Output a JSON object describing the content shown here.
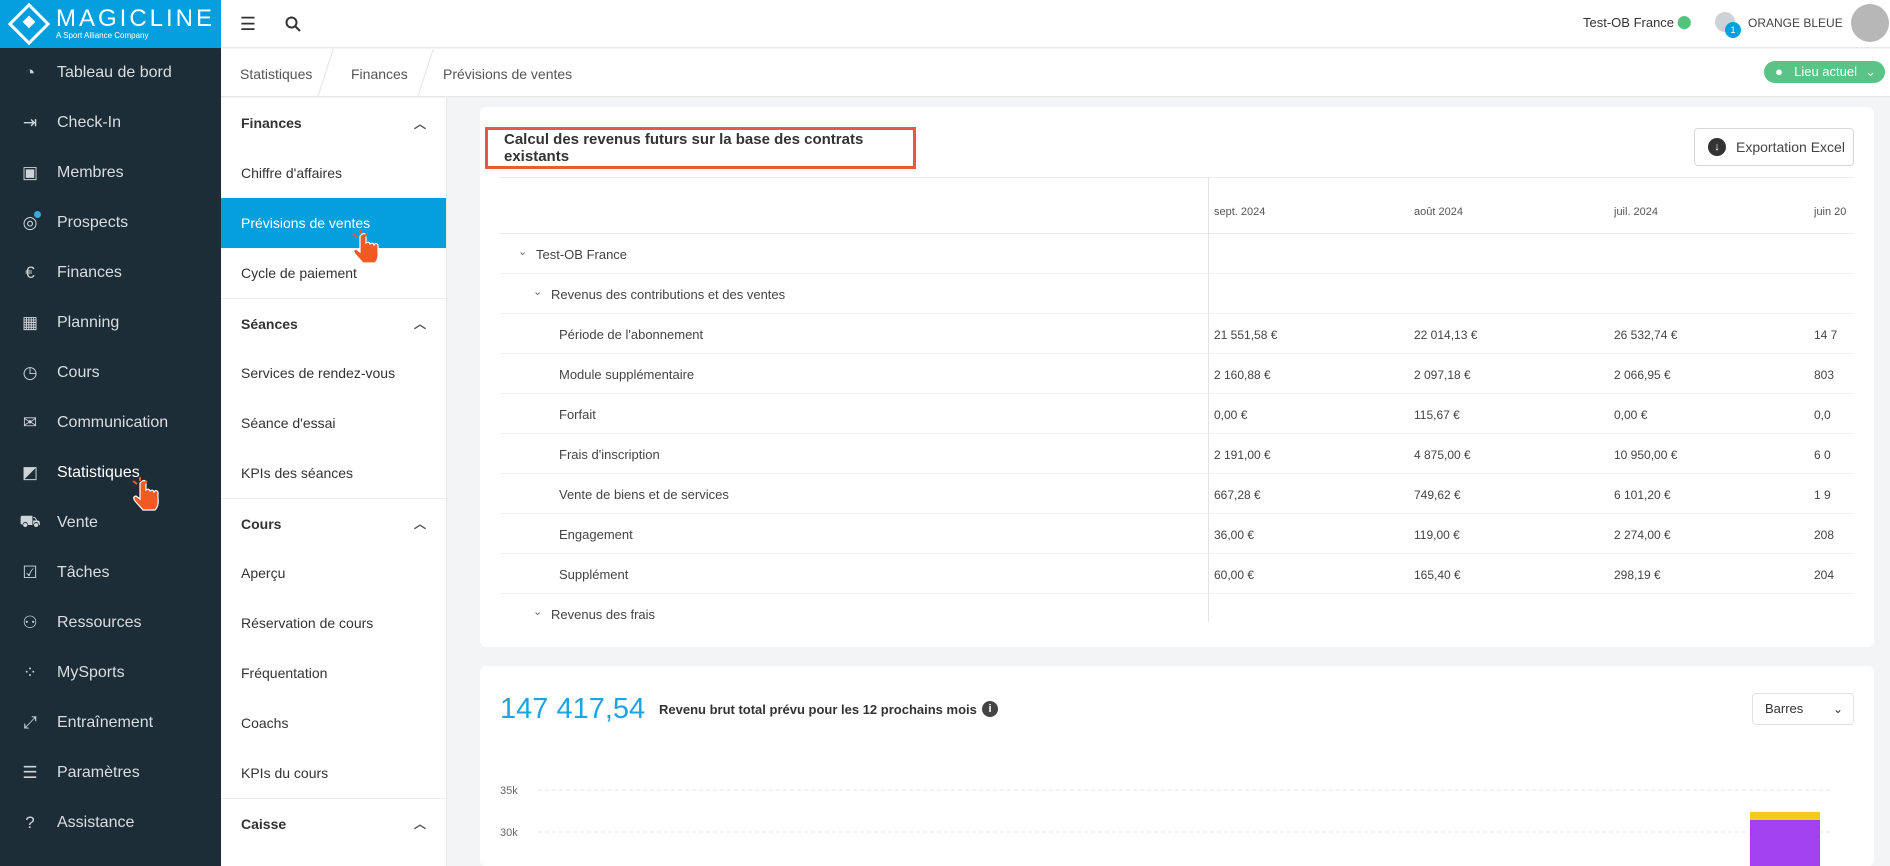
{
  "brand": {
    "name": "MAGICLINE",
    "tagline": "A Sport Alliance Company"
  },
  "sidebar": {
    "items": [
      {
        "label": "Tableau de bord",
        "icon": "dashboard-icon",
        "glyph": "◔"
      },
      {
        "label": "Check-In",
        "icon": "check-in-icon",
        "glyph": "⇥"
      },
      {
        "label": "Membres",
        "icon": "members-icon",
        "glyph": "▣"
      },
      {
        "label": "Prospects",
        "icon": "prospects-icon",
        "glyph": "◎"
      },
      {
        "label": "Finances",
        "icon": "euro-icon",
        "glyph": "€"
      },
      {
        "label": "Planning",
        "icon": "calendar-icon",
        "glyph": "▦"
      },
      {
        "label": "Cours",
        "icon": "stopwatch-icon",
        "glyph": "◷"
      },
      {
        "label": "Communication",
        "icon": "chat-icon",
        "glyph": "✉"
      },
      {
        "label": "Statistiques",
        "icon": "chart-icon",
        "glyph": "◩"
      },
      {
        "label": "Vente",
        "icon": "cart-icon",
        "glyph": "⛟"
      },
      {
        "label": "Tâches",
        "icon": "task-check-icon",
        "glyph": "☑"
      },
      {
        "label": "Ressources",
        "icon": "resources-icon",
        "glyph": "⚇"
      },
      {
        "label": "MySports",
        "icon": "grid-dots-icon",
        "glyph": "⁘"
      },
      {
        "label": "Entraînement",
        "icon": "dumbbell-icon",
        "glyph": "⤢"
      },
      {
        "label": "Paramètres",
        "icon": "sliders-icon",
        "glyph": "☰"
      },
      {
        "label": "Assistance",
        "icon": "help-icon",
        "glyph": "?"
      }
    ]
  },
  "topbar": {
    "location": "Test-OB France",
    "notifications_count": "1",
    "org_name": "ORANGE BLEUE"
  },
  "breadcrumb": {
    "items": [
      "Statistiques",
      "Finances",
      "Prévisions de ventes"
    ],
    "location_button": "Lieu actuel"
  },
  "submenu": {
    "sections": [
      {
        "title": "Finances",
        "items": [
          "Chiffre d'affaires",
          "Prévisions de ventes",
          "Cycle de paiement"
        ]
      },
      {
        "title": "Séances",
        "items": [
          "Services de rendez-vous",
          "Séance d'essai",
          "KPIs des séances"
        ]
      },
      {
        "title": "Cours",
        "items": [
          "Aperçu",
          "Réservation de cours",
          "Fréquentation",
          "Coachs",
          "KPIs du cours"
        ]
      },
      {
        "title": "Caisse",
        "items": []
      }
    ]
  },
  "forecast_card": {
    "title": "Calcul des revenus futurs sur la base des contrats existants",
    "export_label": "Exportation Excel",
    "columns": [
      "sept. 2024",
      "août 2024",
      "juil. 2024",
      "juin 20"
    ],
    "rows": [
      {
        "label": "Test-OB France",
        "level": 0,
        "caret": true,
        "values": [
          "",
          "",
          "",
          ""
        ]
      },
      {
        "label": "Revenus des contributions et des ventes",
        "level": 1,
        "caret": true,
        "values": [
          "",
          "",
          "",
          ""
        ]
      },
      {
        "label": "Période de l'abonnement",
        "level": 2,
        "caret": false,
        "values": [
          "21 551,58 €",
          "22 014,13 €",
          "26 532,74 €",
          "14 7"
        ]
      },
      {
        "label": "Module supplémentaire",
        "level": 2,
        "caret": false,
        "values": [
          "2 160,88 €",
          "2 097,18 €",
          "2 066,95 €",
          "803"
        ]
      },
      {
        "label": "Forfait",
        "level": 2,
        "caret": false,
        "values": [
          "0,00 €",
          "115,67 €",
          "0,00 €",
          "0,0"
        ]
      },
      {
        "label": "Frais d'inscription",
        "level": 2,
        "caret": false,
        "values": [
          "2 191,00 €",
          "4 875,00 €",
          "10 950,00 €",
          "6 0"
        ]
      },
      {
        "label": "Vente de biens et de services",
        "level": 2,
        "caret": false,
        "values": [
          "667,28 €",
          "749,62 €",
          "6 101,20 €",
          "1 9"
        ]
      },
      {
        "label": "Engagement",
        "level": 2,
        "caret": false,
        "values": [
          "36,00 €",
          "119,00 €",
          "2 274,00 €",
          "208"
        ]
      },
      {
        "label": "Supplément",
        "level": 2,
        "caret": false,
        "values": [
          "60,00 €",
          "165,40 €",
          "298,19 €",
          "204"
        ]
      },
      {
        "label": "Revenus des frais",
        "level": 1,
        "caret": true,
        "values": [
          "",
          "",
          "",
          ""
        ]
      }
    ]
  },
  "kpi_card": {
    "value": "147 417,54",
    "label": "Revenu brut total prévu pour les 12 prochains mois",
    "chart_type_select": "Barres"
  },
  "chart_data": {
    "type": "bar",
    "yticks": [
      "35k",
      "30k"
    ],
    "ylim_visible": [
      30000,
      35000
    ],
    "series_colors": [
      "#a241f0",
      "#f2cc1c"
    ]
  }
}
